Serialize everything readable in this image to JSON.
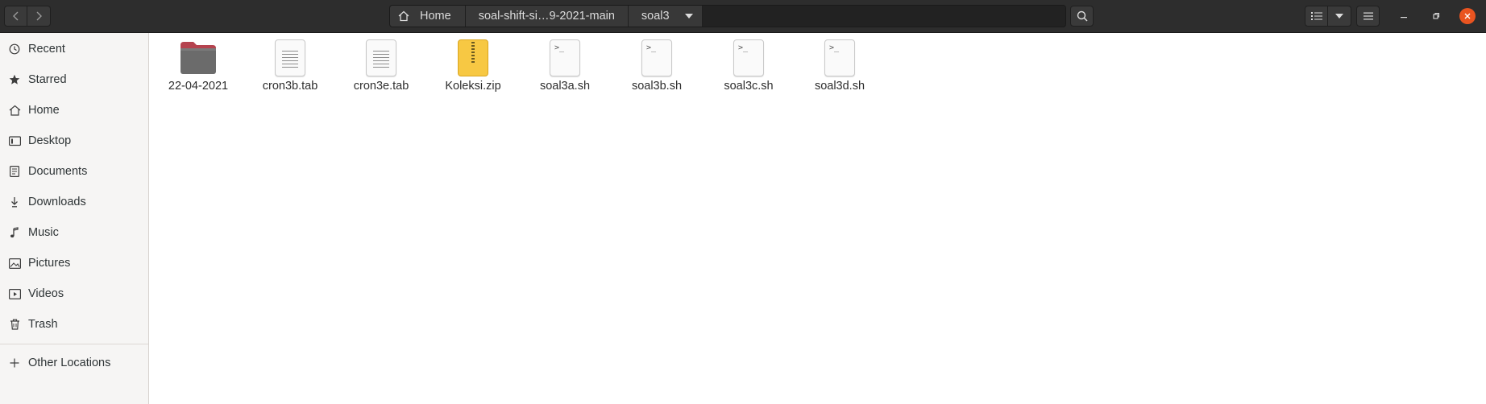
{
  "toolbar": {
    "back_icon": "chevron-left-icon",
    "forward_icon": "chevron-right-icon",
    "search_icon": "search-icon",
    "list_view_icon": "list-view-icon",
    "view_options_icon": "chevron-down-icon",
    "menu_icon": "hamburger-menu-icon"
  },
  "pathbar": {
    "crumbs": [
      {
        "label": "Home",
        "icon": "home-icon"
      },
      {
        "label": "soal-shift-si…9-2021-main"
      },
      {
        "label": "soal3"
      }
    ]
  },
  "window_controls": {
    "minimize_icon": "minimize-icon",
    "maximize_icon": "restore-icon",
    "close_icon": "close-icon",
    "close_color": "#e95420"
  },
  "sidebar": {
    "items": [
      {
        "label": "Recent",
        "icon": "clock-icon"
      },
      {
        "label": "Starred",
        "icon": "star-icon"
      },
      {
        "label": "Home",
        "icon": "home-icon"
      },
      {
        "label": "Desktop",
        "icon": "desktop-icon"
      },
      {
        "label": "Documents",
        "icon": "document-icon"
      },
      {
        "label": "Downloads",
        "icon": "download-icon"
      },
      {
        "label": "Music",
        "icon": "music-icon"
      },
      {
        "label": "Pictures",
        "icon": "pictures-icon"
      },
      {
        "label": "Videos",
        "icon": "video-icon"
      },
      {
        "label": "Trash",
        "icon": "trash-icon"
      }
    ],
    "other_locations": {
      "label": "Other Locations",
      "icon": "plus-icon"
    }
  },
  "files": [
    {
      "name": "22-04-2021",
      "type": "folder"
    },
    {
      "name": "cron3b.tab",
      "type": "text"
    },
    {
      "name": "cron3e.tab",
      "type": "text"
    },
    {
      "name": "Koleksi.zip",
      "type": "archive"
    },
    {
      "name": "soal3a.sh",
      "type": "script"
    },
    {
      "name": "soal3b.sh",
      "type": "script"
    },
    {
      "name": "soal3c.sh",
      "type": "script"
    },
    {
      "name": "soal3d.sh",
      "type": "script"
    }
  ],
  "script_prompt": ">_",
  "colors": {
    "headerbar": "#2d2d2d",
    "sidebar": "#f6f5f4",
    "folder": "#6b6b6b",
    "folder_tab": "#b5434f",
    "archive": "#f7c843",
    "accent": "#e95420"
  }
}
